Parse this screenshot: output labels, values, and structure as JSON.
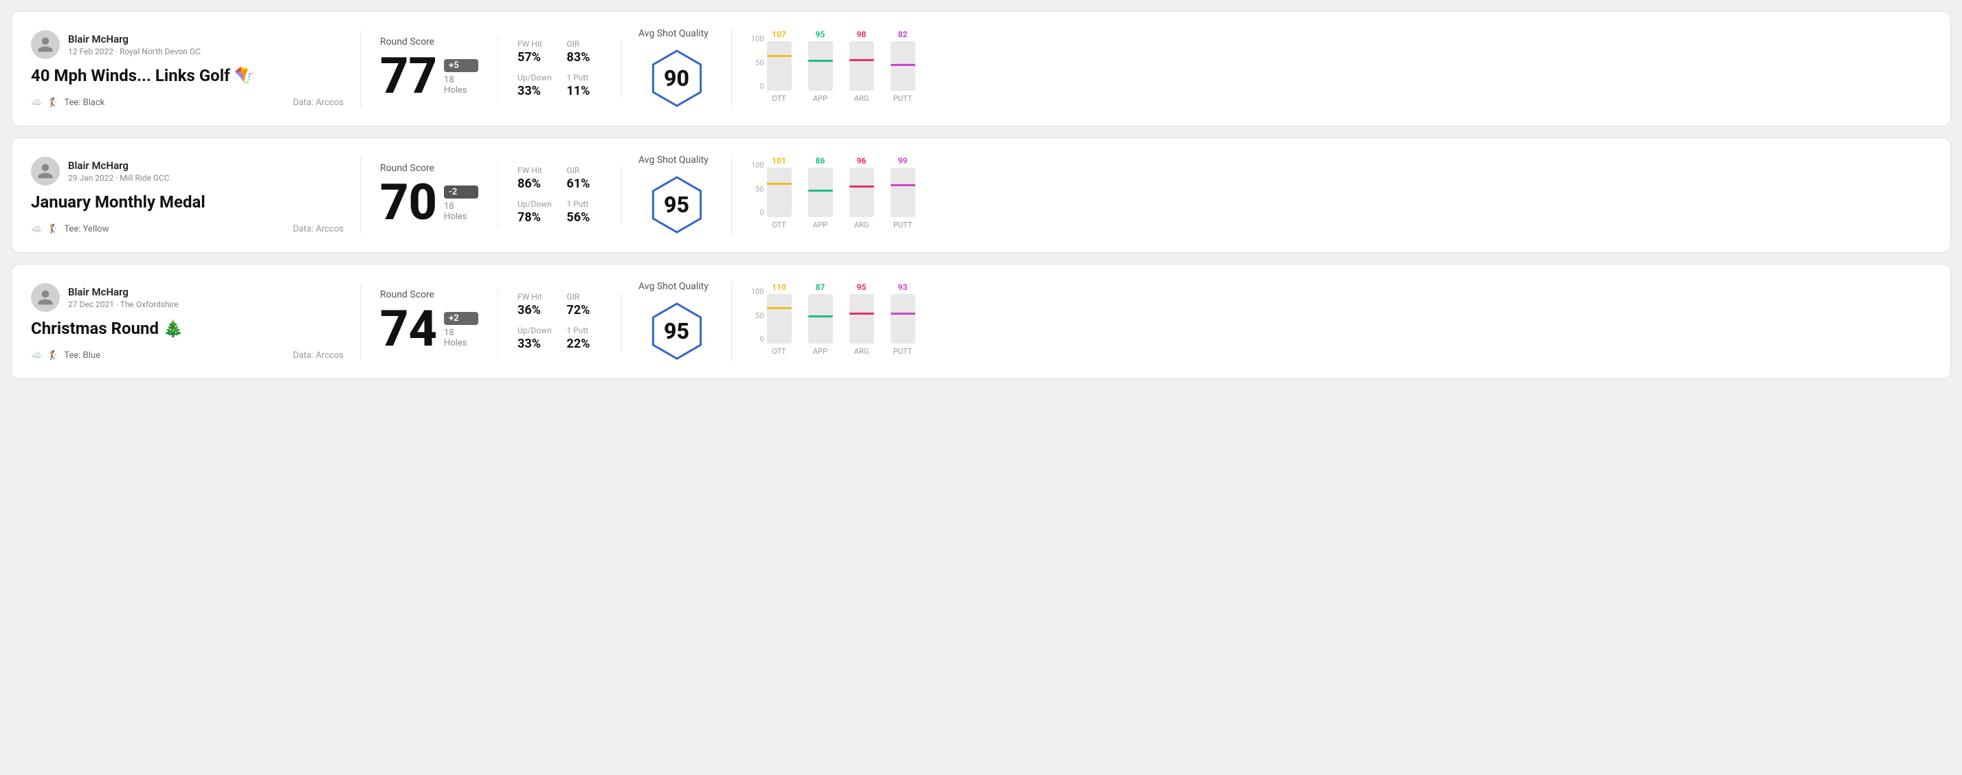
{
  "rounds": [
    {
      "id": "round-1",
      "user": {
        "name": "Blair McHarg",
        "sub": "12 Feb 2022 · Royal North Devon GC"
      },
      "title": "40 Mph Winds... Links Golf 🪁",
      "tee": "Black",
      "data_source": "Data: Arccos",
      "score": {
        "label": "Round Score",
        "value": "77",
        "badge": "+5",
        "badge_type": "positive",
        "holes": "18 Holes"
      },
      "stats": [
        {
          "label": "FW Hit",
          "value": "57%"
        },
        {
          "label": "GIR",
          "value": "83%"
        },
        {
          "label": "Up/Down",
          "value": "33%"
        },
        {
          "label": "1 Putt",
          "value": "11%"
        }
      ],
      "quality": {
        "label": "Avg Shot Quality",
        "score": "90"
      },
      "chart": {
        "bars": [
          {
            "label": "OTT",
            "value": 107,
            "color": "#e8c020",
            "pct": 68
          },
          {
            "label": "APP",
            "value": 95,
            "color": "#22bb88",
            "pct": 58
          },
          {
            "label": "ARG",
            "value": 98,
            "color": "#e83060",
            "pct": 60
          },
          {
            "label": "PUTT",
            "value": 82,
            "color": "#cc44cc",
            "pct": 50
          }
        ]
      }
    },
    {
      "id": "round-2",
      "user": {
        "name": "Blair McHarg",
        "sub": "29 Jan 2022 · Mill Ride GCC"
      },
      "title": "January Monthly Medal",
      "tee": "Yellow",
      "data_source": "Data: Arccos",
      "score": {
        "label": "Round Score",
        "value": "70",
        "badge": "-2",
        "badge_type": "negative",
        "holes": "18 Holes"
      },
      "stats": [
        {
          "label": "FW Hit",
          "value": "86%"
        },
        {
          "label": "GIR",
          "value": "61%"
        },
        {
          "label": "Up/Down",
          "value": "78%"
        },
        {
          "label": "1 Putt",
          "value": "56%"
        }
      ],
      "quality": {
        "label": "Avg Shot Quality",
        "score": "95"
      },
      "chart": {
        "bars": [
          {
            "label": "OTT",
            "value": 101,
            "color": "#e8c020",
            "pct": 65
          },
          {
            "label": "APP",
            "value": 86,
            "color": "#22bb88",
            "pct": 52
          },
          {
            "label": "ARG",
            "value": 96,
            "color": "#e83060",
            "pct": 60
          },
          {
            "label": "PUTT",
            "value": 99,
            "color": "#cc44cc",
            "pct": 62
          }
        ]
      }
    },
    {
      "id": "round-3",
      "user": {
        "name": "Blair McHarg",
        "sub": "27 Dec 2021 · The Oxfordshire"
      },
      "title": "Christmas Round 🎄",
      "tee": "Blue",
      "data_source": "Data: Arccos",
      "score": {
        "label": "Round Score",
        "value": "74",
        "badge": "+2",
        "badge_type": "positive",
        "holes": "18 Holes"
      },
      "stats": [
        {
          "label": "FW Hit",
          "value": "36%"
        },
        {
          "label": "GIR",
          "value": "72%"
        },
        {
          "label": "Up/Down",
          "value": "33%"
        },
        {
          "label": "1 Putt",
          "value": "22%"
        }
      ],
      "quality": {
        "label": "Avg Shot Quality",
        "score": "95"
      },
      "chart": {
        "bars": [
          {
            "label": "OTT",
            "value": 110,
            "color": "#e8c020",
            "pct": 70
          },
          {
            "label": "APP",
            "value": 87,
            "color": "#22bb88",
            "pct": 53
          },
          {
            "label": "ARG",
            "value": 95,
            "color": "#e83060",
            "pct": 59
          },
          {
            "label": "PUTT",
            "value": 93,
            "color": "#cc44cc",
            "pct": 58
          }
        ]
      }
    }
  ],
  "chart_y_labels": [
    "100",
    "50",
    "0"
  ]
}
